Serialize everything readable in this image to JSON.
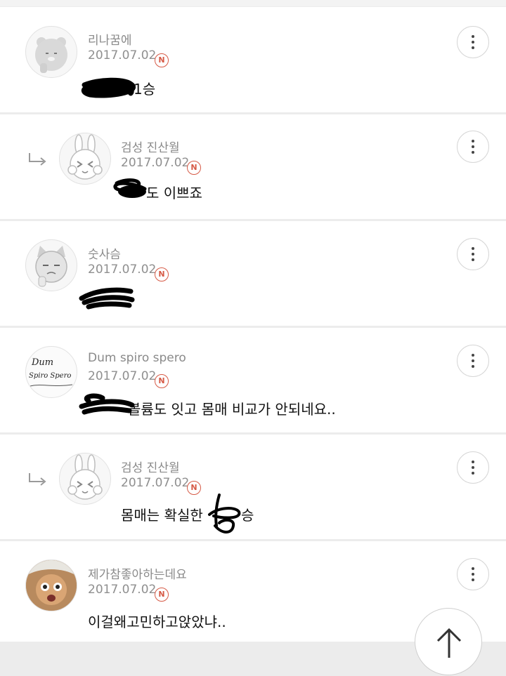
{
  "comments": [
    {
      "author": "리나꿈에",
      "date": "2017.07.02",
      "badge": "N",
      "text": "1승",
      "avatar_icon": "bear-character-icon",
      "reply": false
    },
    {
      "author": "검성 진산월",
      "date": "2017.07.02",
      "badge": "N",
      "text": "도 이쁘죠",
      "avatar_icon": "rabbit-character-icon",
      "reply": true
    },
    {
      "author": "숫사슴",
      "date": "2017.07.02",
      "badge": "N",
      "text": "",
      "avatar_icon": "cat-character-icon",
      "reply": false
    },
    {
      "author": "Dum spiro spero",
      "date": "2017.07.02",
      "badge": "N",
      "text": "볼륨도 잇고 몸매 비교가 안되네요..",
      "avatar_icon": "calligraphy-avatar-icon",
      "reply": false
    },
    {
      "author": "검성 진산월",
      "date": "2017.07.02",
      "badge": "N",
      "text": "몸매는 확실한",
      "text_suffix": "승",
      "avatar_icon": "rabbit-character-icon",
      "reply": true
    },
    {
      "author": "제가참좋아하는데요",
      "date": "2017.07.02",
      "badge": "N",
      "text": "이걸왜고민하고앉았냐..",
      "avatar_icon": "photo-avatar-icon",
      "reply": false
    }
  ],
  "avatar_calligraphy": {
    "line1": "Dum",
    "line2": "Spiro Spero"
  },
  "icons": {
    "more": "more-vertical-icon",
    "reply": "reply-arrow-icon",
    "scroll_top": "arrow-up-icon"
  },
  "colors": {
    "badge": "#d65a46",
    "divider": "#ececec"
  }
}
